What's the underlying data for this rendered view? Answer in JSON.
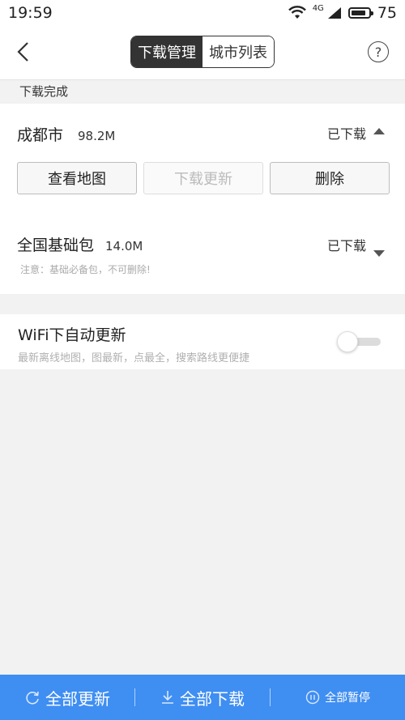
{
  "status_bar": {
    "time": "19:59",
    "network": "4G",
    "battery": "75"
  },
  "nav": {
    "tabs": [
      {
        "label": "下载管理",
        "active": true
      },
      {
        "label": "城市列表",
        "active": false
      }
    ]
  },
  "section": {
    "title": "下载完成"
  },
  "city": {
    "name": "成都市",
    "size": "98.2M",
    "status": "已下载",
    "buttons": {
      "view": "查看地图",
      "update": "下载更新",
      "delete": "删除"
    }
  },
  "base_package": {
    "name": "全国基础包",
    "size": "14.0M",
    "status": "已下载",
    "note": "注意：基础必备包，不可删除!"
  },
  "wifi_setting": {
    "title": "WiFi下自动更新",
    "description": "最新离线地图，图最新，点最全，搜索路线更便捷",
    "enabled": false
  },
  "bottom_bar": {
    "update_all": "全部更新",
    "download_all": "全部下载",
    "third": "全部暂停"
  },
  "colors": {
    "accent": "#3f8ef2",
    "tab_active_bg": "#333333"
  }
}
